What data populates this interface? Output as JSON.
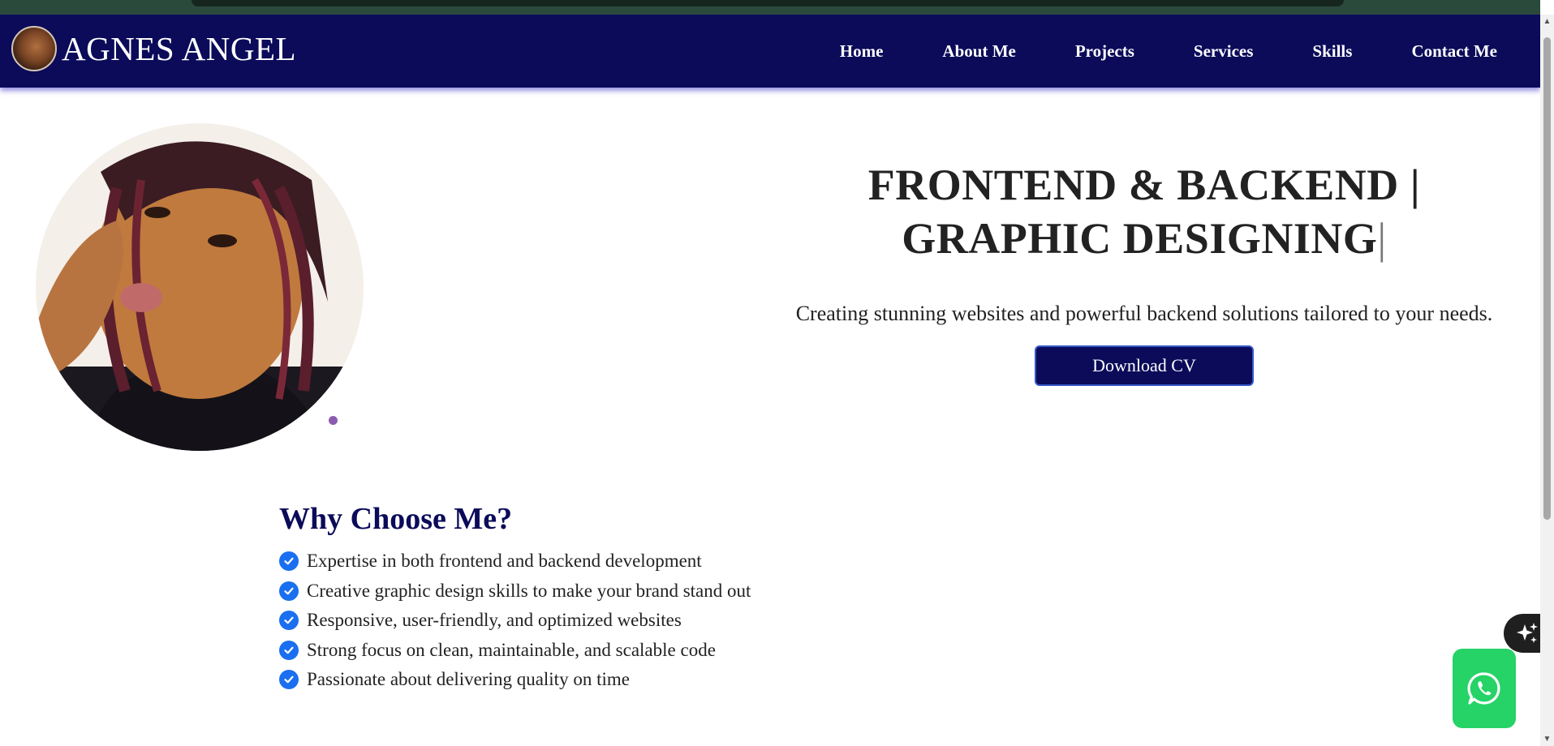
{
  "brand": {
    "name": "AGNES ANGEL"
  },
  "nav": {
    "items": [
      {
        "label": "Home"
      },
      {
        "label": "About Me"
      },
      {
        "label": "Projects"
      },
      {
        "label": "Services"
      },
      {
        "label": "Skills"
      },
      {
        "label": "Contact Me"
      }
    ]
  },
  "hero": {
    "title_line1": "FRONTEND & BACKEND |",
    "title_line2": "GRAPHIC DESIGNING",
    "cursor": "|",
    "subtitle": "Creating stunning websites and powerful backend solutions tailored to your needs.",
    "cta_label": "Download CV"
  },
  "why": {
    "title": "Why Choose Me?",
    "items": [
      "Expertise in both frontend and backend development",
      "Creative graphic design skills to make your brand stand out",
      "Responsive, user-friendly, and optimized websites",
      "Strong focus on clean, maintainable, and scalable code",
      "Passionate about delivering quality on time"
    ]
  },
  "icons": {
    "check": "check-circle-icon",
    "ai": "sparkles-icon",
    "whatsapp": "whatsapp-icon"
  },
  "colors": {
    "navbar": "#0b0b5a",
    "accent": "#1a6ff0",
    "whatsapp": "#25d366",
    "heading": "#0b0b5a"
  }
}
